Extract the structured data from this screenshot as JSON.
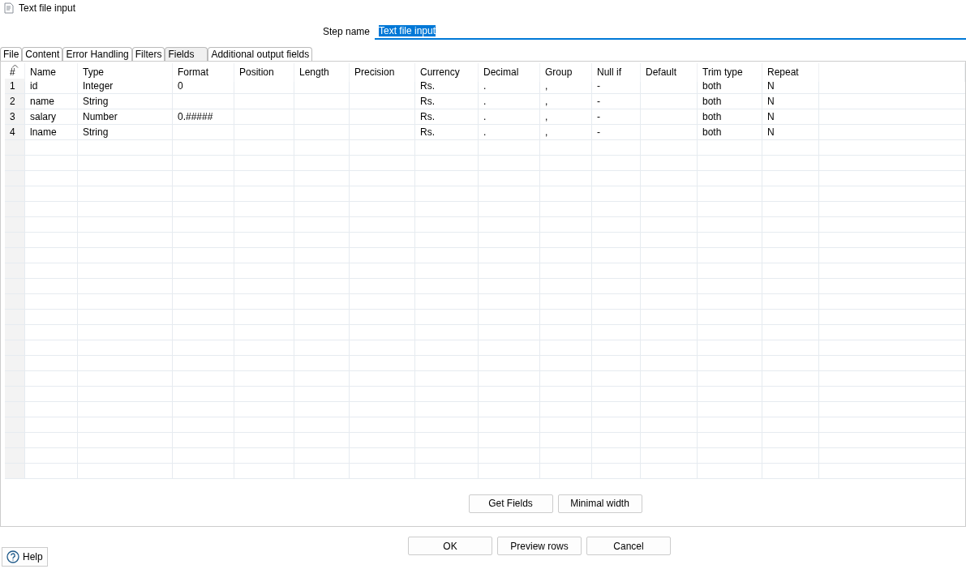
{
  "window": {
    "title": "Text file input"
  },
  "step_name": {
    "label": "Step name",
    "value": "Text file input"
  },
  "tabs": [
    {
      "label": "File",
      "selected": false
    },
    {
      "label": "Content",
      "selected": false
    },
    {
      "label": "Error Handling",
      "selected": false
    },
    {
      "label": "Filters",
      "selected": false
    },
    {
      "label": "Fields",
      "selected": true
    },
    {
      "label": "Additional output fields",
      "selected": false
    }
  ],
  "table": {
    "columns": [
      "#",
      "Name",
      "Type",
      "Format",
      "Position",
      "Length",
      "Precision",
      "Currency",
      "Decimal",
      "Group",
      "Null if",
      "Default",
      "Trim type",
      "Repeat"
    ],
    "rows": [
      [
        "1",
        "id",
        "Integer",
        "0",
        "",
        "",
        "",
        "Rs.",
        ".",
        ",",
        "-",
        "",
        "both",
        "N"
      ],
      [
        "2",
        "name",
        "String",
        "",
        "",
        "",
        "",
        "Rs.",
        ".",
        ",",
        "-",
        "",
        "both",
        "N"
      ],
      [
        "3",
        "salary",
        "Number",
        "0.#####",
        "",
        "",
        "",
        "Rs.",
        ".",
        ",",
        "-",
        "",
        "both",
        "N"
      ],
      [
        "4",
        "lname",
        "String",
        "",
        "",
        "",
        "",
        "Rs.",
        ".",
        ",",
        "-",
        "",
        "both",
        "N"
      ]
    ]
  },
  "table_buttons": [
    "Get Fields",
    "Minimal width"
  ],
  "dialog_buttons": [
    "OK",
    "Preview rows",
    "Cancel"
  ],
  "help_button": "Help"
}
